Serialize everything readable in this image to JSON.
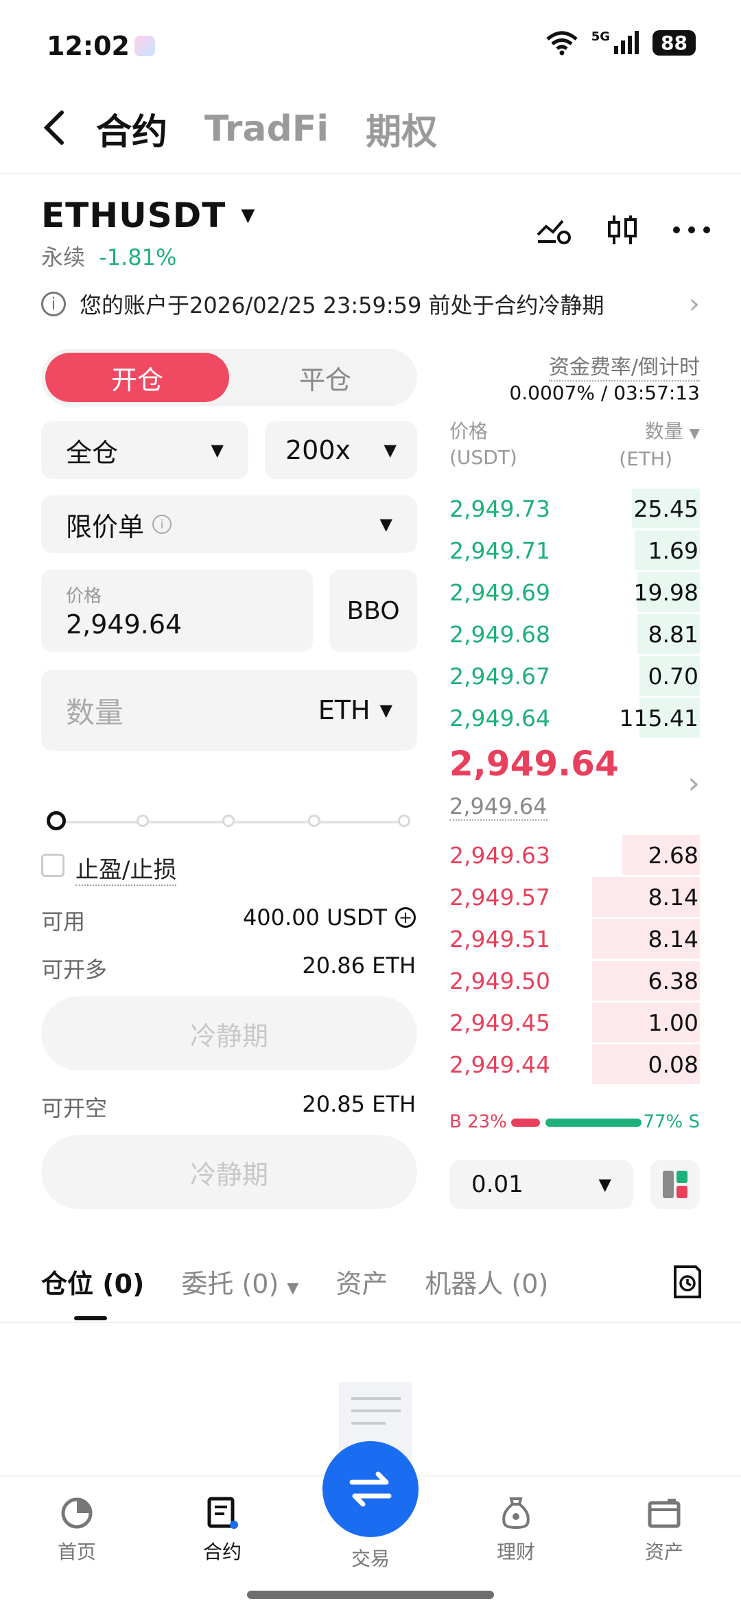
{
  "status": {
    "time": "12:02",
    "network": "5G",
    "battery": "88"
  },
  "top_tabs": [
    {
      "label": "合约",
      "active": true
    },
    {
      "label": "TradFi",
      "active": false
    },
    {
      "label": "期权",
      "active": false
    }
  ],
  "symbol": {
    "name": "ETHUSDT",
    "type": "永续",
    "change": "-1.81%"
  },
  "notice": "您的账户于2026/02/25 23:59:59 前处于合约冷静期",
  "order_form": {
    "side_tabs": [
      "开仓",
      "平仓"
    ],
    "margin_mode": "全仓",
    "leverage": "200x",
    "order_type": "限价单",
    "price_label": "价格",
    "price_value": "2,949.64",
    "bbo_label": "BBO",
    "qty_placeholder": "数量",
    "qty_unit": "ETH",
    "slider_pct": 0,
    "tpsl_label": "止盈/止损",
    "available_label": "可用",
    "available_value": "400.00 USDT",
    "max_long_label": "可开多",
    "max_long_value": "20.86 ETH",
    "long_button": "冷静期",
    "max_short_label": "可开空",
    "max_short_value": "20.85 ETH",
    "short_button": "冷静期"
  },
  "orderbook": {
    "funding_label": "资金费率/倒计时",
    "funding_value": "0.0007% / 03:57:13",
    "col_price": "价格",
    "col_price_unit": "(USDT)",
    "col_qty": "数量",
    "col_qty_unit": "(ETH)",
    "asks_green": [
      {
        "price": "2,949.73",
        "qty": "25.45",
        "depth": 0.27
      },
      {
        "price": "2,949.71",
        "qty": "1.69",
        "depth": 0.26
      },
      {
        "price": "2,949.69",
        "qty": "19.98",
        "depth": 0.25
      },
      {
        "price": "2,949.68",
        "qty": "8.81",
        "depth": 0.25
      },
      {
        "price": "2,949.67",
        "qty": "0.70",
        "depth": 0.24
      },
      {
        "price": "2,949.64",
        "qty": "115.41",
        "depth": 0.24
      }
    ],
    "last_price": "2,949.64",
    "mark_price": "2,949.64",
    "bids_red": [
      {
        "price": "2,949.63",
        "qty": "2.68",
        "depth": 0.31
      },
      {
        "price": "2,949.57",
        "qty": "8.14",
        "depth": 0.43
      },
      {
        "price": "2,949.51",
        "qty": "8.14",
        "depth": 0.43
      },
      {
        "price": "2,949.50",
        "qty": "6.38",
        "depth": 0.43
      },
      {
        "price": "2,949.45",
        "qty": "1.00",
        "depth": 0.43
      },
      {
        "price": "2,949.44",
        "qty": "0.08",
        "depth": 0.43
      }
    ],
    "buy_ratio": "B 23%",
    "sell_ratio": "77% S",
    "buy_pct": 23,
    "precision": "0.01"
  },
  "bottom_tabs": [
    "仓位 (0)",
    "委托 (0)",
    "资产",
    "机器人 (0)"
  ],
  "nav": [
    "首页",
    "合约",
    "交易",
    "理财",
    "资产"
  ],
  "colors": {
    "green": "#1eb07a",
    "red": "#e8405c",
    "accent": "#1a6cf0"
  }
}
